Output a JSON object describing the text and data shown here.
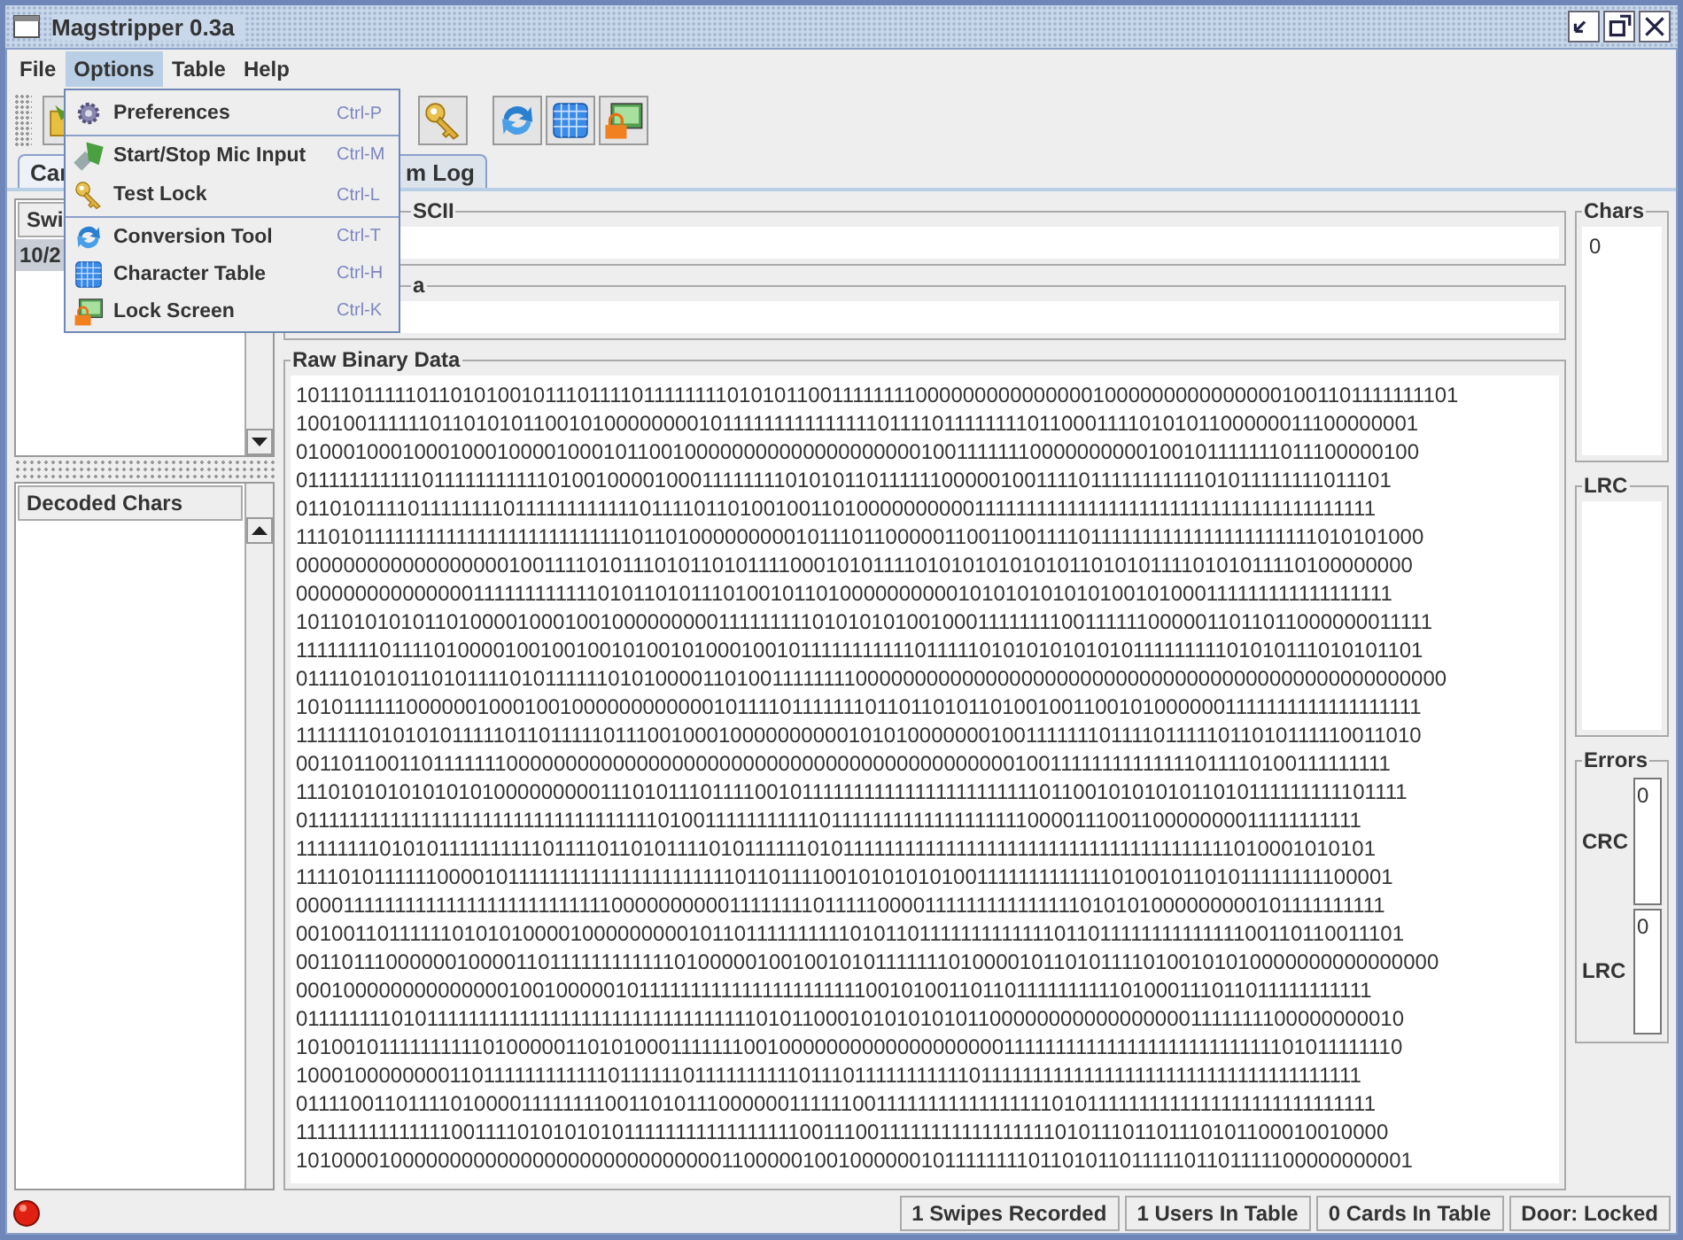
{
  "window": {
    "title": "Magstripper 0.3a"
  },
  "menu_bar": [
    {
      "label": "File",
      "selected": false
    },
    {
      "label": "Options",
      "selected": true
    },
    {
      "label": "Table",
      "selected": false
    },
    {
      "label": "Help",
      "selected": false
    }
  ],
  "open_menu": {
    "items": [
      {
        "kind": "gear",
        "label": "Preferences",
        "shortcut": "Ctrl-P",
        "separator_after": true
      },
      {
        "kind": "mic",
        "label": "Start/Stop Mic Input",
        "shortcut": "Ctrl-M",
        "separator_after": false
      },
      {
        "kind": "key",
        "label": "Test Lock",
        "shortcut": "Ctrl-L",
        "separator_after": true
      },
      {
        "kind": "refresh",
        "label": "Conversion Tool",
        "shortcut": "Ctrl-T",
        "separator_after": false
      },
      {
        "kind": "grid",
        "label": "Character Table",
        "shortcut": "Ctrl-H",
        "separator_after": false
      },
      {
        "kind": "lock",
        "label": "Lock Screen",
        "shortcut": "Ctrl-K",
        "separator_after": false
      }
    ]
  },
  "toolbar": [
    {
      "kind": "folder"
    },
    {
      "kind": "key"
    },
    {
      "kind": "refresh"
    },
    {
      "kind": "grid"
    },
    {
      "kind": "lock"
    }
  ],
  "tabs": [
    {
      "label": "Car",
      "selected": true
    },
    {
      "label": "m Log",
      "selected": false
    }
  ],
  "swipes_table": {
    "column_1": "Swi",
    "rows": [
      {
        "cell": "10/2",
        "selected": true
      }
    ]
  },
  "decoded_chars_table": {
    "column_1": "Decoded Chars"
  },
  "panels": [
    {
      "legend": "SCII"
    },
    {
      "legend": "a"
    }
  ],
  "raw_binary_data": {
    "legend": "Raw Binary Data",
    "lines": [
      "1011101111101101010010111011110111111110101011001111111100000000000000010000000000000001001101111111101",
      "1001001111110110101011001010000000010111111111111111011110111111110110001111010101100000011100000001",
      "0100010001000100010000100010110010000000000000000000010011111110000000000100101111111011100000100",
      "0111111111110111111111110100100001000111111110101011011111100000100111101111111111101011111111011101",
      "0110101111011111111011111111111101111011010010011010000000000111111111111111111111111111111111111111",
      "1110101111111111111111111111111101101000000000101110110000011001100111101111111111111111111111010101000",
      "0000000000000000001001111010111010110101111000101011110101010101010110101011110101011110100000000",
      "0000000000000001111111111110101101011101001011010000000000101010101010100101000111111111111111111",
      "1011010101011010000100010010000000001111111110101010100100011111111001111110000011011011000000011111",
      "1111111101111010000100100100101001010001001011111111111011111010101010101011111111101010111010101101",
      "0111101010110101111010111111010100001101001111111100000000000000000000000000000000000000000000000000",
      "1010111111000000100010010000000000001011110111111101101101011010010011001010000001111111111111111111",
      "1111111010101011111011011111011100100010000000000101010000000100111111101111011111011010111110011010",
      "0011011001101111111000000000000000000000000000000000000000000010011111111111111011110100111111111",
      "1110101010101010100000000011101011101111001011111111111111111111111011001010101011010111111111101111",
      "0111111111111111111111111111111111101001111111111101111111111111111111000011100110000000011111111111",
      "1111111101010111111111101111011010111101011111101011111111111111111111111111111111111111010001010101",
      "1111010111111000010111111111111111111111101101111001010101010011111111111110100101101011111111100001",
      "0000111111111111111111111111110000000000111111110111110000111111111111111010101000000000101111111111",
      "0010011011111101010100001000000000101101111111111010110111111111111101101111111111111100110110011101",
      "0011011100000010000110111111111111010000010010010101111111010000101101011110100101010000000000000000",
      "0001000000000000001001000001011111111111111111111110010100110110111111111101000111011011111111111",
      "0111111110101111111111111111111111111111111101011000101010101011000000000000000001111111100000000010",
      "1010010111111111101000001101010001111111001000000000000000000011111111111111111111111111101011111110",
      "1000100000000110111111111111011111101111111111011101111111111101111111111111111111111111111111111111",
      "0111100110111101000011111111001101011100000011111100111111111111111110101111111111111111111111111111",
      "1111111111111110011110101010101111111111111111100111001111111111111111101011101101110101100010010000",
      "1010000100000000000000000000000000001100000100100000010111111110110101101111101101111100000000001"
    ]
  },
  "chars": {
    "legend": "Chars",
    "value": "0"
  },
  "lrc": {
    "legend": "LRC"
  },
  "errors": {
    "legend": "Errors",
    "rows": [
      {
        "label": "CRC",
        "value": "0"
      },
      {
        "label": "LRC",
        "value": "0"
      }
    ]
  },
  "status_bar": {
    "cells": [
      "1 Swipes Recorded",
      "1 Users In Table",
      "0 Cards In Table",
      "Door: Locked"
    ]
  }
}
